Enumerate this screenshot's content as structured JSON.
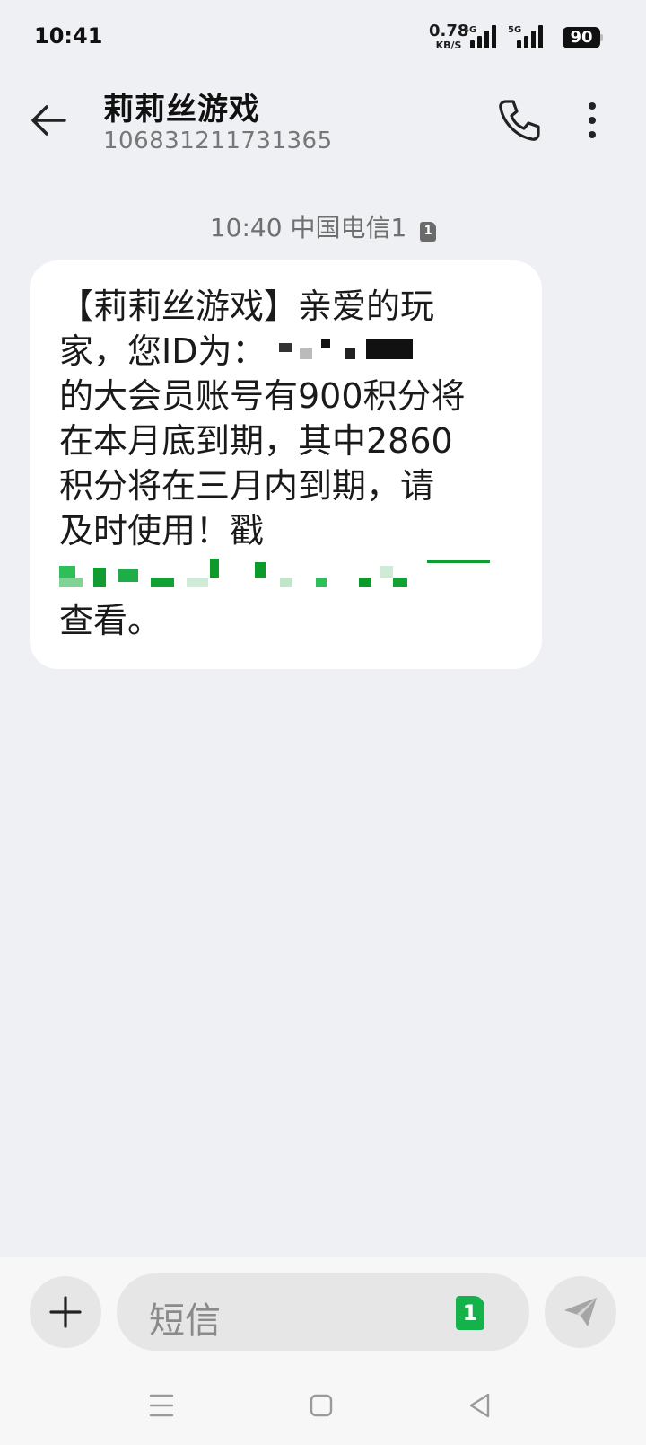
{
  "status_bar": {
    "time": "10:41",
    "net_speed_value": "0.78",
    "net_speed_unit": "KB/S",
    "sim1_label": "4G",
    "sim2_label": "5G",
    "battery": "90"
  },
  "header": {
    "contact_name": "莉莉丝游戏",
    "contact_number": "106831211731365"
  },
  "message_meta": {
    "time": "10:40",
    "carrier": "中国电信1",
    "sim_slot": "1"
  },
  "message": {
    "lines": [
      "【莉莉丝游戏】亲爱的玩",
      "家，您ID为：",
      "的大会员账号有900积分将",
      "在本月底到期，其中2860",
      "积分将在三月内到期，请",
      "及时使用！戳",
      "",
      "查看。"
    ]
  },
  "input_bar": {
    "placeholder": "短信",
    "sim_slot": "1"
  },
  "icons": {
    "back": "back-arrow-icon",
    "call": "phone-icon",
    "more": "more-vertical-icon",
    "add": "plus-icon",
    "send": "send-icon",
    "nav_menu": "menu-icon",
    "nav_home": "home-icon",
    "nav_back": "nav-back-icon"
  },
  "colors": {
    "background": "#eff0f3",
    "bubble": "#ffffff",
    "sim_select": "#15b14a",
    "link_redaction": "#14a33a"
  }
}
